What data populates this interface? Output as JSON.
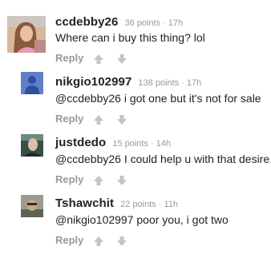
{
  "reply_label": "Reply",
  "icon_color": "#c4c4c4",
  "comments": [
    {
      "username": "ccdebby26",
      "points": "36 points",
      "separator": "·",
      "time": "17h",
      "text": "Where can i buy this thing? lol",
      "avatar_icon": "user-photo-avatar"
    },
    {
      "username": "nikgio102997",
      "points": "138 points",
      "separator": "·",
      "time": "17h",
      "text": "@ccdebby26 i got one but it's not for sale",
      "avatar_icon": "default-user-avatar-icon",
      "avatar_color": "#5f7fc8"
    },
    {
      "username": "justdedo",
      "points": "15 points",
      "separator": "·",
      "time": "14h",
      "text": "@ccdebby26 I could help u with that desire.",
      "avatar_icon": "user-photo-avatar"
    },
    {
      "username": "Tshawchit",
      "points": "22 points",
      "separator": "·",
      "time": "11h",
      "text": "@nikgio102997 poor you, i got two",
      "avatar_icon": "user-photo-avatar"
    }
  ]
}
